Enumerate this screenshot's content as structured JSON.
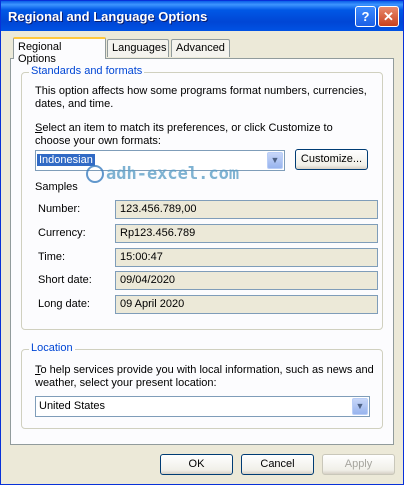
{
  "window": {
    "title": "Regional and Language Options",
    "help_glyph": "?",
    "close_glyph": "✕"
  },
  "tabs": [
    {
      "label": "Regional Options"
    },
    {
      "label": "Languages"
    },
    {
      "label": "Advanced"
    }
  ],
  "standards": {
    "group_title": "Standards and formats",
    "description": "This option affects how some programs format numbers, currencies, dates, and time.",
    "instruction": "Select an item to match its preferences, or click Customize to choose your own formats:",
    "selected_locale": "Indonesian",
    "customize_label": "Customize...",
    "samples_label": "Samples",
    "samples": [
      {
        "label": "Number:",
        "value": "123.456.789,00"
      },
      {
        "label": "Currency:",
        "value": "Rp123.456.789"
      },
      {
        "label": "Time:",
        "value": "15:00:47"
      },
      {
        "label": "Short date:",
        "value": "09/04/2020"
      },
      {
        "label": "Long date:",
        "value": "09 April 2020"
      }
    ]
  },
  "location": {
    "group_title": "Location",
    "description": "To help services provide you with local information, such as news and weather, select your present location:",
    "selected": "United States"
  },
  "footer": {
    "ok_label": "OK",
    "cancel_label": "Cancel",
    "apply_label": "Apply"
  },
  "watermark": {
    "text": "adh-excel.com"
  }
}
